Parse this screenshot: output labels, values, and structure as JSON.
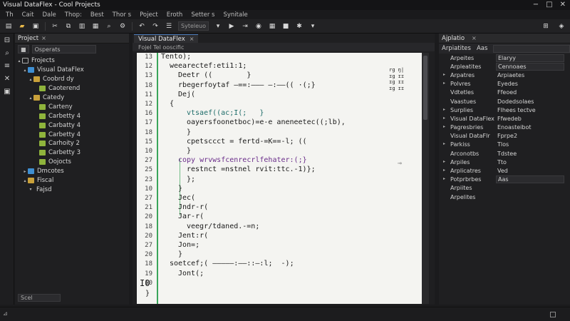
{
  "window": {
    "title": "Visual DataFlex  -  Cool Projects",
    "controls": [
      "−",
      "□",
      "✕"
    ]
  },
  "menu": [
    "Th",
    "Cait",
    "Dale",
    "Thop:",
    "Best",
    "Thor s",
    "Poject",
    "Eroth",
    "Setter s",
    "Synitale"
  ],
  "toolbar": {
    "combo": "Syteleuo"
  },
  "explorer": {
    "header": "Project",
    "close": "×",
    "combo_left": "■",
    "combo_right": "Osperats",
    "tree": [
      {
        "arrow": "▴",
        "icon": "n",
        "label": "Frojects"
      },
      {
        "arrow": "▴",
        "icon": "b",
        "label": "Visual DataFlex"
      },
      {
        "arrow": "▴",
        "icon": "f",
        "label": "Coobrd dy"
      },
      {
        "arrow": "",
        "icon": "g",
        "label": "Caoterend"
      },
      {
        "arrow": "▴",
        "icon": "f",
        "label": "Catedy"
      },
      {
        "arrow": "",
        "icon": "g",
        "label": "Carteny"
      },
      {
        "arrow": "",
        "icon": "g",
        "label": "Carbetty 4"
      },
      {
        "arrow": "",
        "icon": "g",
        "label": "Carbatty 4"
      },
      {
        "arrow": "",
        "icon": "g",
        "label": "Carbetty 4"
      },
      {
        "arrow": "",
        "icon": "g",
        "label": "Carhoity 2"
      },
      {
        "arrow": "",
        "icon": "g",
        "label": "Carbetty 3"
      },
      {
        "arrow": "",
        "icon": "g",
        "label": "Oojocts"
      },
      {
        "arrow": "▸",
        "icon": "b",
        "label": "Dmcotes"
      },
      {
        "arrow": "▴",
        "icon": "f",
        "label": "Fiscal"
      },
      {
        "arrow": "▾",
        "icon": "",
        "label": "Fajsd"
      }
    ],
    "footer": "Scel"
  },
  "editor": {
    "tab": "Visual DataFlex",
    "tab_close": "×",
    "breadcrumb": "Fojel Tel ooscific",
    "line_numbers": [
      "13",
      "12",
      "13",
      "18",
      "11",
      "12",
      "16",
      "17",
      "18",
      "15",
      "10",
      "27",
      "25",
      "23",
      "10",
      "27",
      "21",
      "20",
      "18",
      "20",
      "27",
      "20",
      "18",
      "19",
      "10"
    ],
    "lines": [
      {
        "text": "Tento);",
        "indent": 0,
        "color": "dark"
      },
      {
        "text": "weearectef:eti1:1;",
        "indent": 1,
        "color": "dark"
      },
      {
        "text": "Deetr ((        }",
        "indent": 2,
        "color": "dark"
      },
      {
        "text": "rbegerfoytaf —==:——— —:——(( ·(;}",
        "indent": 2,
        "color": "dark"
      },
      {
        "text": "Dej(",
        "indent": 2,
        "color": "dark"
      },
      {
        "text": "{",
        "indent": 1,
        "color": "dark"
      },
      {
        "text": "vtsaef((ac;I(;   }",
        "indent": 3,
        "color": "teal"
      },
      {
        "text": "oayersfoonetboc)=e-e aneneetec((;lb),",
        "indent": 3,
        "color": "dark"
      },
      {
        "text": "}",
        "indent": 3,
        "color": "dark"
      },
      {
        "text": "cpetsccct = fertd-=K==-l; ((",
        "indent": 3,
        "color": "dark"
      },
      {
        "text": "}",
        "indent": 3,
        "color": "dark"
      },
      {
        "text": "copy wrvwsfcenrecrlfehater:(;}",
        "indent": 2,
        "color": "purple"
      },
      {
        "text": "restnct =nstnel rvit:ttc.-1)};",
        "indent": 3,
        "color": "dark"
      },
      {
        "text": "};",
        "indent": 3,
        "color": "dark"
      },
      {
        "text": "}",
        "indent": 2,
        "color": "dark"
      },
      {
        "text": "Jec(",
        "indent": 2,
        "color": "dark"
      },
      {
        "text": "Jndr-r(",
        "indent": 2,
        "color": "dark"
      },
      {
        "text": "Jar-r(",
        "indent": 2,
        "color": "dark"
      },
      {
        "text": "veegr/tdaned.-=n;",
        "indent": 3,
        "color": "dark"
      },
      {
        "text": "Jent:r(",
        "indent": 2,
        "color": "dark"
      },
      {
        "text": "Jon=;",
        "indent": 2,
        "color": "dark"
      },
      {
        "text": "}",
        "indent": 2,
        "color": "dark"
      },
      {
        "text": "soetcef;( —————:——::—:l;  -);",
        "indent": 1,
        "color": "dark"
      },
      {
        "text": "Jont(;",
        "indent": 2,
        "color": "dark"
      },
      {
        "text": "",
        "indent": 0,
        "color": "dark"
      },
      {
        "text": "",
        "indent": 0,
        "color": "dark"
      }
    ],
    "last_line_number": "I0",
    "last_line": "}",
    "minimap": [
      "rg ŋ|",
      "ɪɡ ɪɪ",
      "ɪɡ ɪɪ",
      "ɪɡ ɪɪ"
    ],
    "margin_mark": "⊸"
  },
  "properties": {
    "header": "Ajplatio",
    "close": "×",
    "sub_label": "Arpiatites",
    "sub_a": "Aas",
    "rows": [
      {
        "arrow": "",
        "name": "Arpeites",
        "value": "Elaryy",
        "boxed": true
      },
      {
        "arrow": "",
        "name": "Arpleatites",
        "value": "Cennoaes",
        "boxed": true
      },
      {
        "arrow": "▸",
        "name": "Arpatres",
        "value": "Arpiaetes",
        "boxed": false
      },
      {
        "arrow": "▸",
        "name": "Polvres",
        "value": "Eyedes",
        "boxed": false
      },
      {
        "arrow": "",
        "name": "Vdtetles",
        "value": "Ffeoed",
        "boxed": false
      },
      {
        "arrow": "",
        "name": "Vaastues",
        "value": "Dodedsolaes",
        "boxed": false
      },
      {
        "arrow": "▸",
        "name": "Surplies",
        "value": "Flhees tectve",
        "boxed": false
      },
      {
        "arrow": "▸",
        "name": "Visual DataFlex",
        "value": "Ffwedeb",
        "boxed": false
      },
      {
        "arrow": "▸",
        "name": "Pagresbries",
        "value": "Enoasteibot",
        "boxed": false
      },
      {
        "arrow": "",
        "name": "Visual DataFlr",
        "value": "Fprpe2",
        "boxed": false
      },
      {
        "arrow": "▸",
        "name": "Parkiss",
        "value": "Tlos",
        "boxed": false
      },
      {
        "arrow": "",
        "name": "Arconotbs",
        "value": "Tdstee",
        "boxed": false
      },
      {
        "arrow": "▸",
        "name": "Arpiles",
        "value": "Tto",
        "boxed": false
      },
      {
        "arrow": "▸",
        "name": "Arplicatres",
        "value": "Ved",
        "boxed": false
      },
      {
        "arrow": "▸",
        "name": "Potprbrbes",
        "value": "Aas",
        "boxed": true
      },
      {
        "arrow": "",
        "name": "Arpiites",
        "value": "",
        "boxed": false
      },
      {
        "arrow": "",
        "name": "Arpelites",
        "value": "",
        "boxed": false
      }
    ]
  },
  "status": {
    "left": "⊿"
  }
}
